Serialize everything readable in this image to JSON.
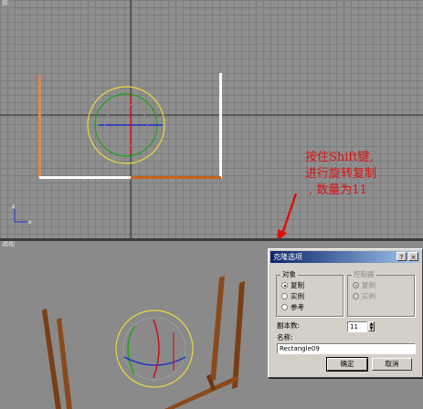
{
  "viewports": {
    "top_label": "前",
    "persp_label": "透视"
  },
  "annotation": {
    "lines": [
      "按住Shift键,",
      "进行旋转复制",
      ", 数量为11"
    ],
    "color": "#e01010"
  },
  "dialog": {
    "title": "克隆选项",
    "help_btn": "?",
    "close_btn": "×",
    "object_group": {
      "legend": "对象",
      "options": [
        "复制",
        "实例",
        "参考"
      ],
      "selected": "复制"
    },
    "controller_group": {
      "legend": "控制器",
      "options": [
        "复制",
        "实例"
      ],
      "selected": "复制",
      "disabled": true
    },
    "copies_label": "副本数:",
    "copies_value": "11",
    "name_label": "名称:",
    "name_value": "Rectangle09",
    "ok_label": "确定",
    "cancel_label": "取消"
  },
  "colors": {
    "ring_yellow": "#e8d840",
    "axis_red": "#c81414",
    "axis_green": "#1fa21f",
    "axis_blue": "#2030c8",
    "wood": "#8a4a1c",
    "titlebar": "#0a246a"
  }
}
